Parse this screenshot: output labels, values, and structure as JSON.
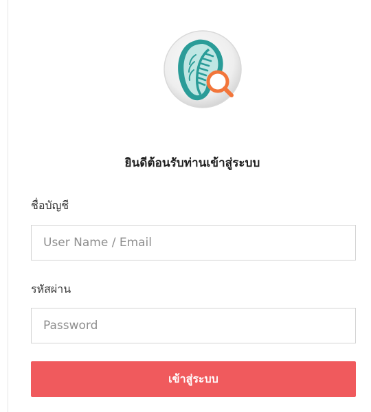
{
  "brand": {
    "logo_icon": "spine-magnifier-logo-icon",
    "accent_color": "#f05a5d",
    "logo_color": "#2a9c98"
  },
  "header": {
    "welcome_text": "ยินดีต้อนรับท่านเข้าสู่ระบบ"
  },
  "form": {
    "username_label": "ชื่อบัญชี",
    "username_placeholder": "User Name / Email",
    "username_value": "",
    "password_label": "รหัสผ่าน",
    "password_placeholder": "Password",
    "password_value": "",
    "submit_label": "เข้าสู่ระบบ"
  }
}
